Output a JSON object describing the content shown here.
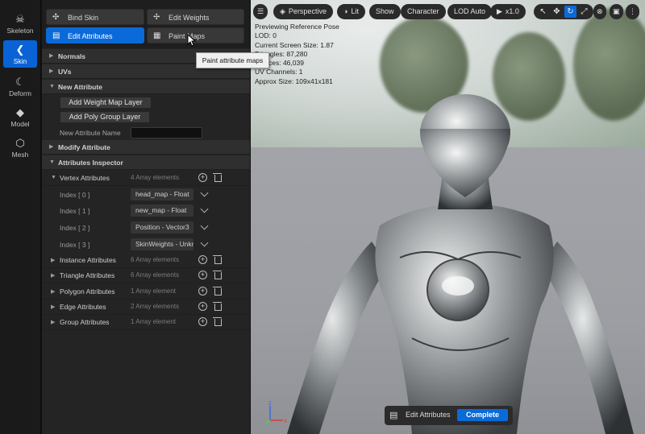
{
  "rail": {
    "modes": [
      {
        "label": "Skeleton",
        "icon": "skeleton-icon"
      },
      {
        "label": "Skin",
        "icon": "skin-icon"
      },
      {
        "label": "Deform",
        "icon": "deform-icon"
      },
      {
        "label": "Model",
        "icon": "model-icon"
      },
      {
        "label": "Mesh",
        "icon": "mesh-icon"
      }
    ],
    "active": "Skin"
  },
  "toolbar": {
    "bind_skin": "Bind Skin",
    "edit_weights": "Edit Weights",
    "edit_attributes": "Edit Attributes",
    "paint_maps": "Paint Maps"
  },
  "tooltip": "Paint attribute maps",
  "sections": {
    "normals": "Normals",
    "uvs": "UVs",
    "new_attribute": "New Attribute",
    "modify_attribute": "Modify Attribute",
    "attributes_inspector": "Attributes Inspector"
  },
  "new_attribute": {
    "add_weight_map_layer": "Add Weight Map Layer",
    "add_poly_group_layer": "Add Poly Group Layer",
    "name_label": "New Attribute Name",
    "name_value": ""
  },
  "inspector": {
    "vertex": {
      "label": "Vertex Attributes",
      "count": "4 Array elements"
    },
    "indices": [
      {
        "label": "Index [ 0 ]",
        "value": "head_map - Float"
      },
      {
        "label": "Index [ 1 ]",
        "value": "new_map - Float"
      },
      {
        "label": "Index [ 2 ]",
        "value": "Position - Vector3"
      },
      {
        "label": "Index [ 3 ]",
        "value": "SkinWeights - Unkno"
      }
    ],
    "others": [
      {
        "label": "Instance Attributes",
        "count": "6 Array elements"
      },
      {
        "label": "Triangle Attributes",
        "count": "6 Array elements"
      },
      {
        "label": "Polygon Attributes",
        "count": "1 Array element"
      },
      {
        "label": "Edge Attributes",
        "count": "2 Array elements"
      },
      {
        "label": "Group Attributes",
        "count": "1 Array element"
      }
    ]
  },
  "viewport": {
    "perspective": "Perspective",
    "lit": "Lit",
    "show": "Show",
    "character": "Character",
    "lod": "LOD Auto",
    "speed": "x1.0",
    "stats": [
      "Previewing Reference Pose",
      "LOD: 0",
      "Current Screen Size: 1.87",
      "Triangles: 87,280",
      "Vertices: 46,039",
      "UV Channels: 1",
      "Approx Size: 109x41x181"
    ],
    "axis_labels": {
      "x": "X",
      "y": "Y",
      "z": "Z"
    }
  },
  "mode_bar": {
    "label": "Edit Attributes",
    "complete": "Complete"
  },
  "colors": {
    "accent": "#0b6ad9",
    "panel": "#242424",
    "rail": "#1a1a1a"
  }
}
